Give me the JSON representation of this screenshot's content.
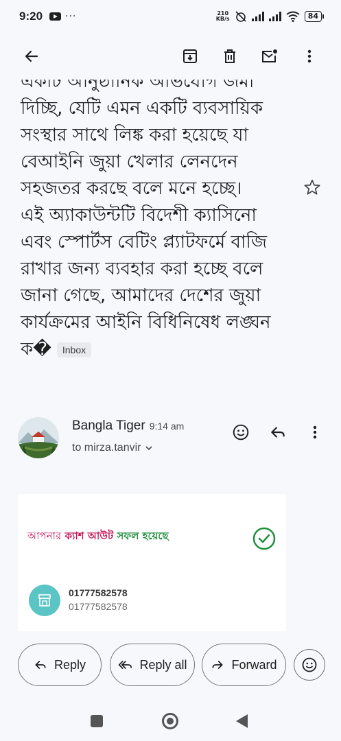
{
  "status_bar": {
    "time": "9:20",
    "dots": "···",
    "net_speed_value": "210",
    "net_speed_unit": "KB/s",
    "battery": "84"
  },
  "app_bar": {
    "icons": [
      "back-arrow-icon",
      "archive-icon",
      "delete-icon",
      "mark-unread-icon",
      "more-vert-icon"
    ]
  },
  "email": {
    "subject_lines": [
      "একটি আনুষ্ঠানিক অভিযোগ জমা",
      "দিচ্ছি, যেটি এমন একটি ব্যবসায়িক",
      "সংস্থার সাথে লিঙ্ক করা হয়েছে যা",
      "বেআইনি জুয়া খেলার লেনদেন",
      "সহজতর করছে বলে মনে হচ্ছে।",
      "এই অ্যাকাউন্টটি বিদেশী ক্যাসিনো",
      "এবং স্পোর্টস বেটিং প্ল্যাটফর্মে বাজি",
      "রাখার জন্য ব্যবহার করা হচ্ছে বলে",
      "জানা গেছে, আমাদের দেশের জুয়া",
      "কার্যক্রমের আইনি বিধিনিষেধ লঙ্ঘন",
      "ক�"
    ],
    "label_chip": "Inbox",
    "sender_name": "Bangla Tiger",
    "sent_time": "9:14 am",
    "recipient": "to mirza.tanvir",
    "card": {
      "title_part1": "আপনার",
      "title_part2": "ক্যাশ আউট",
      "title_part3": "সফল হয়েছে",
      "number_primary": "01777582578",
      "number_secondary": "01777582578"
    }
  },
  "actions": {
    "reply": "Reply",
    "reply_all": "Reply all",
    "forward": "Forward"
  },
  "colors": {
    "background": "#f6f8fc",
    "cash_pink": "#c2185b",
    "success_green": "#1e8e3e",
    "merchant_teal": "#5bc4c4"
  }
}
